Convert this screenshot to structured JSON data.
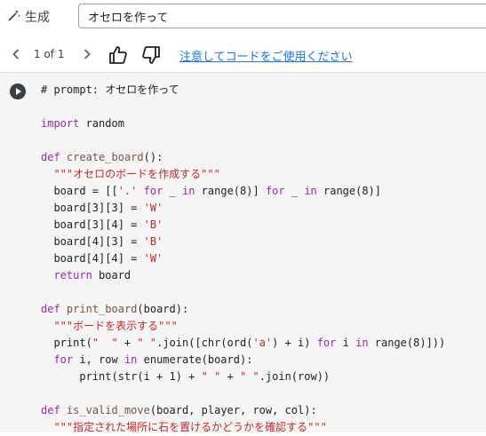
{
  "toolbar": {
    "generate_label": "生成",
    "generate_icon": "magic-wand-icon",
    "prompt_value": "オセロを作って"
  },
  "nav": {
    "prev_icon": "chevron-left-icon",
    "count": "1 of 1",
    "next_icon": "chevron-right-icon",
    "thumb_up_icon": "thumb-up-icon",
    "thumb_down_icon": "thumb-down-icon",
    "notice": "注意してコードをご使用ください",
    "link_color": "#1a73e8"
  },
  "code": {
    "run_icon": "play-icon",
    "lines": [
      [
        {
          "t": "# prompt: オセロを作って",
          "c": "cm"
        }
      ],
      [],
      [
        {
          "t": "import",
          "c": "kw"
        },
        {
          "t": " random",
          "c": ""
        }
      ],
      [],
      [
        {
          "t": "def",
          "c": "kw"
        },
        {
          "t": " ",
          "c": ""
        },
        {
          "t": "create_board",
          "c": "fn"
        },
        {
          "t": "():",
          "c": ""
        }
      ],
      [
        {
          "t": "  ",
          "c": ""
        },
        {
          "t": "\"\"\"オセロのボードを作成する\"\"\"",
          "c": "str"
        }
      ],
      [
        {
          "t": "  board = [[",
          "c": ""
        },
        {
          "t": "'.'",
          "c": "str"
        },
        {
          "t": " ",
          "c": ""
        },
        {
          "t": "for",
          "c": "kw"
        },
        {
          "t": " _ ",
          "c": ""
        },
        {
          "t": "in",
          "c": "kw"
        },
        {
          "t": " range(8)] ",
          "c": ""
        },
        {
          "t": "for",
          "c": "kw"
        },
        {
          "t": " _ ",
          "c": ""
        },
        {
          "t": "in",
          "c": "kw"
        },
        {
          "t": " range(8)]",
          "c": ""
        }
      ],
      [
        {
          "t": "  board[3][3] = ",
          "c": ""
        },
        {
          "t": "'W'",
          "c": "str"
        }
      ],
      [
        {
          "t": "  board[3][4] = ",
          "c": ""
        },
        {
          "t": "'B'",
          "c": "str"
        }
      ],
      [
        {
          "t": "  board[4][3] = ",
          "c": ""
        },
        {
          "t": "'B'",
          "c": "str"
        }
      ],
      [
        {
          "t": "  board[4][4] = ",
          "c": ""
        },
        {
          "t": "'W'",
          "c": "str"
        }
      ],
      [
        {
          "t": "  ",
          "c": ""
        },
        {
          "t": "return",
          "c": "kw"
        },
        {
          "t": " board",
          "c": ""
        }
      ],
      [],
      [
        {
          "t": "def",
          "c": "kw"
        },
        {
          "t": " ",
          "c": ""
        },
        {
          "t": "print_board",
          "c": "fn"
        },
        {
          "t": "(board):",
          "c": ""
        }
      ],
      [
        {
          "t": "  ",
          "c": ""
        },
        {
          "t": "\"\"\"ボードを表示する\"\"\"",
          "c": "str"
        }
      ],
      [
        {
          "t": "  print(",
          "c": ""
        },
        {
          "t": "\"  \"",
          "c": "str"
        },
        {
          "t": " + ",
          "c": ""
        },
        {
          "t": "\" \"",
          "c": "str"
        },
        {
          "t": ".join([chr(ord(",
          "c": ""
        },
        {
          "t": "'a'",
          "c": "str"
        },
        {
          "t": ") + i) ",
          "c": ""
        },
        {
          "t": "for",
          "c": "kw"
        },
        {
          "t": " i ",
          "c": ""
        },
        {
          "t": "in",
          "c": "kw"
        },
        {
          "t": " range(8)]))",
          "c": ""
        }
      ],
      [
        {
          "t": "  ",
          "c": ""
        },
        {
          "t": "for",
          "c": "kw"
        },
        {
          "t": " i, row ",
          "c": ""
        },
        {
          "t": "in",
          "c": "kw"
        },
        {
          "t": " enumerate(board):",
          "c": ""
        }
      ],
      [
        {
          "t": "      print(str(i + 1) + ",
          "c": ""
        },
        {
          "t": "\" \"",
          "c": "str"
        },
        {
          "t": " + ",
          "c": ""
        },
        {
          "t": "\" \"",
          "c": "str"
        },
        {
          "t": ".join(row))",
          "c": ""
        }
      ],
      [],
      [
        {
          "t": "def",
          "c": "kw"
        },
        {
          "t": " ",
          "c": ""
        },
        {
          "t": "is_valid_move",
          "c": "fn"
        },
        {
          "t": "(board, player, row, col):",
          "c": ""
        }
      ],
      [
        {
          "t": "  ",
          "c": ""
        },
        {
          "t": "\"\"\"指定された場所に石を置けるかどうかを確認する\"\"\"",
          "c": "str"
        }
      ]
    ]
  }
}
